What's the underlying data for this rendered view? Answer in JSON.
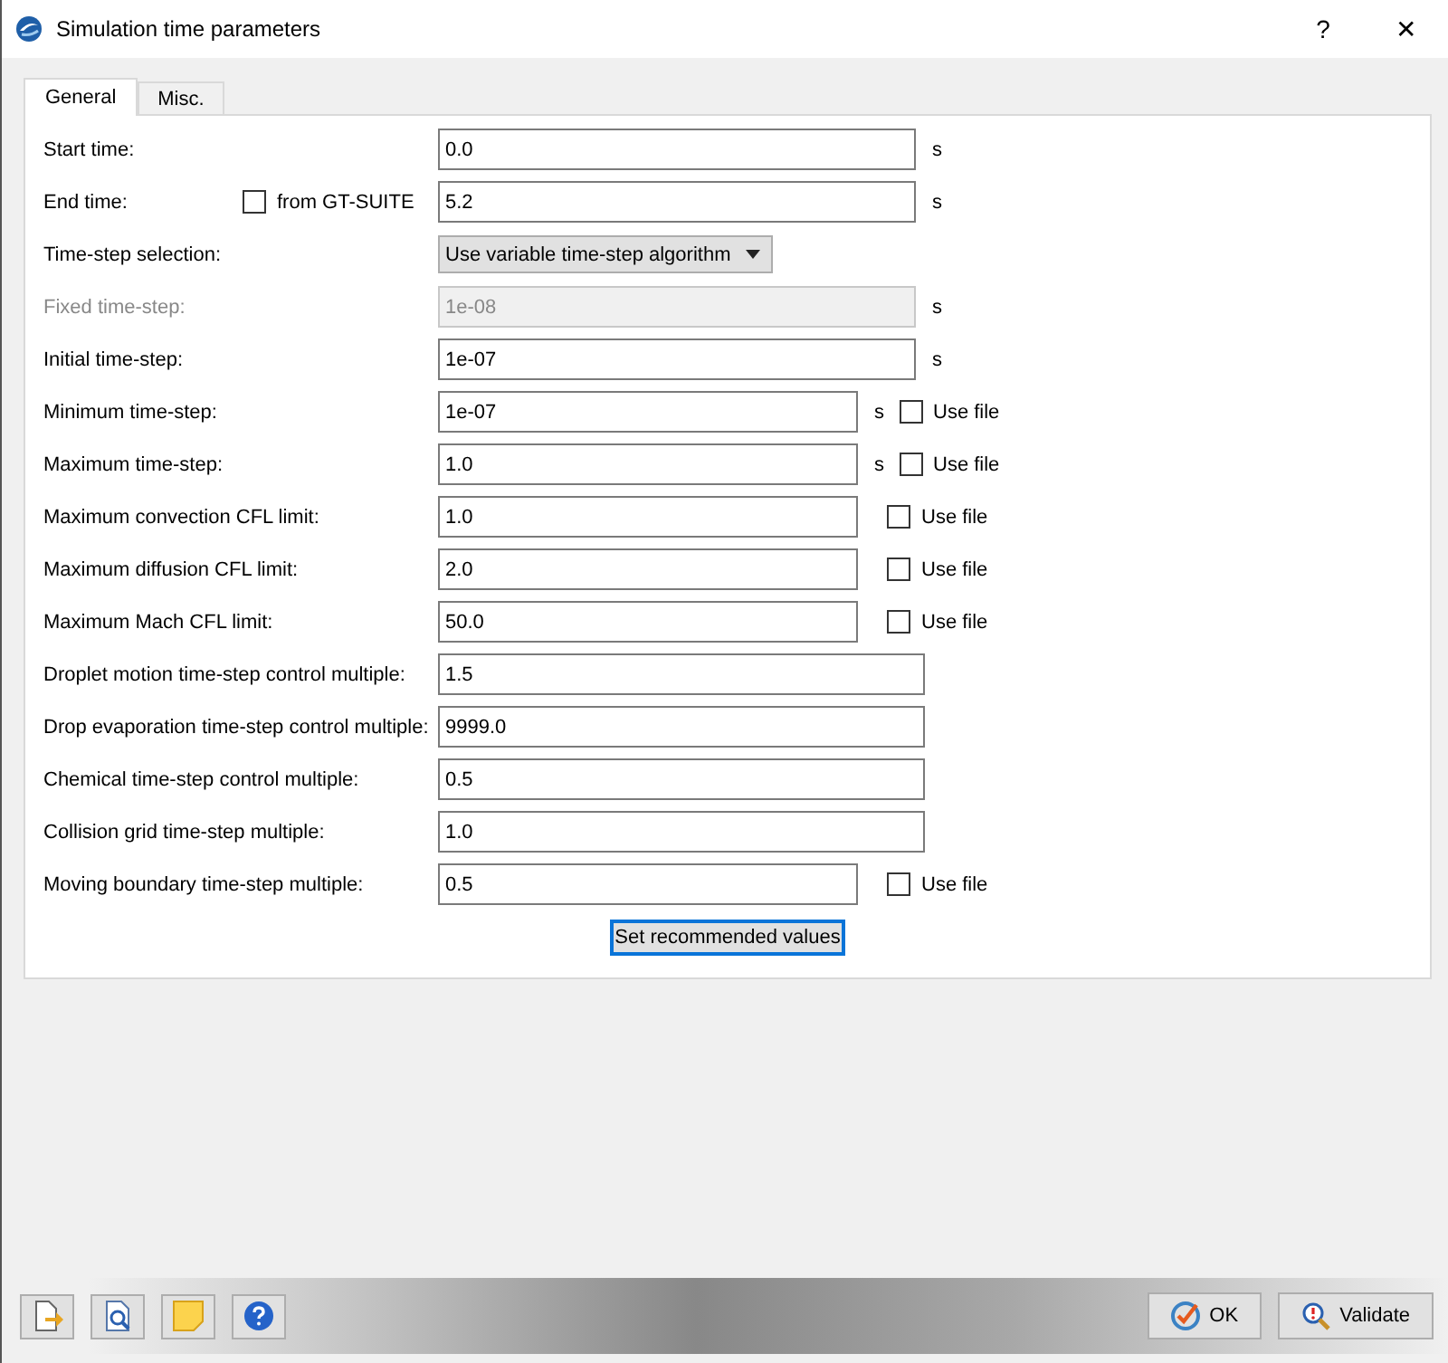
{
  "window": {
    "title": "Simulation time parameters",
    "help": "?",
    "close": "✕"
  },
  "tabs": [
    {
      "label": "General",
      "selected": true
    },
    {
      "label": "Misc.",
      "selected": false
    }
  ],
  "rows": [
    {
      "kind": "field",
      "label": "Start time:",
      "value": "0.0",
      "unit": "s",
      "disabled": false
    },
    {
      "kind": "field",
      "label": "End time:",
      "value": "5.2",
      "unit": "s",
      "disabled": false,
      "source_checkbox": {
        "label": "from GT-SUITE",
        "checked": false
      }
    },
    {
      "kind": "dropdown",
      "label": "Time-step selection:",
      "value": "Use variable time-step algorithm"
    },
    {
      "kind": "field",
      "label": "Fixed time-step:",
      "value": "1e-08",
      "unit": "s",
      "disabled": true
    },
    {
      "kind": "field",
      "label": "Initial time-step:",
      "value": "1e-07",
      "unit": "s",
      "disabled": false
    },
    {
      "kind": "field",
      "label": "Minimum time-step:",
      "value": "1e-07",
      "unit": "s",
      "disabled": false,
      "use_file": {
        "label": "Use file",
        "checked": false
      }
    },
    {
      "kind": "field",
      "label": "Maximum time-step:",
      "value": "1.0",
      "unit": "s",
      "disabled": false,
      "use_file": {
        "label": "Use file",
        "checked": false
      }
    },
    {
      "kind": "field",
      "label": "Maximum convection CFL limit:",
      "value": "1.0",
      "disabled": false,
      "use_file": {
        "label": "Use file",
        "checked": false
      }
    },
    {
      "kind": "field",
      "label": "Maximum diffusion CFL limit:",
      "value": "2.0",
      "disabled": false,
      "use_file": {
        "label": "Use file",
        "checked": false
      }
    },
    {
      "kind": "field",
      "label": "Maximum Mach CFL limit:",
      "value": "50.0",
      "disabled": false,
      "use_file": {
        "label": "Use file",
        "checked": false
      }
    },
    {
      "kind": "field",
      "label": "Droplet motion time-step control multiple:",
      "value": "1.5",
      "disabled": false
    },
    {
      "kind": "field",
      "label": "Drop evaporation time-step control multiple:",
      "value": "9999.0",
      "disabled": false
    },
    {
      "kind": "field",
      "label": "Chemical time-step control multiple:",
      "value": "0.5",
      "disabled": false
    },
    {
      "kind": "field",
      "label": "Collision grid time-step multiple:",
      "value": "1.0",
      "disabled": false
    },
    {
      "kind": "field",
      "label": "Moving boundary time-step multiple:",
      "value": "0.5",
      "disabled": false,
      "use_file": {
        "label": "Use file",
        "checked": false
      }
    }
  ],
  "recommend_button": "Set recommended values",
  "footer": {
    "tools": [
      {
        "kind": "export"
      },
      {
        "kind": "preview"
      },
      {
        "kind": "note"
      },
      {
        "kind": "help"
      }
    ],
    "buttons": [
      {
        "kind": "ok",
        "label": "OK"
      },
      {
        "kind": "validate",
        "label": "Validate"
      }
    ]
  }
}
